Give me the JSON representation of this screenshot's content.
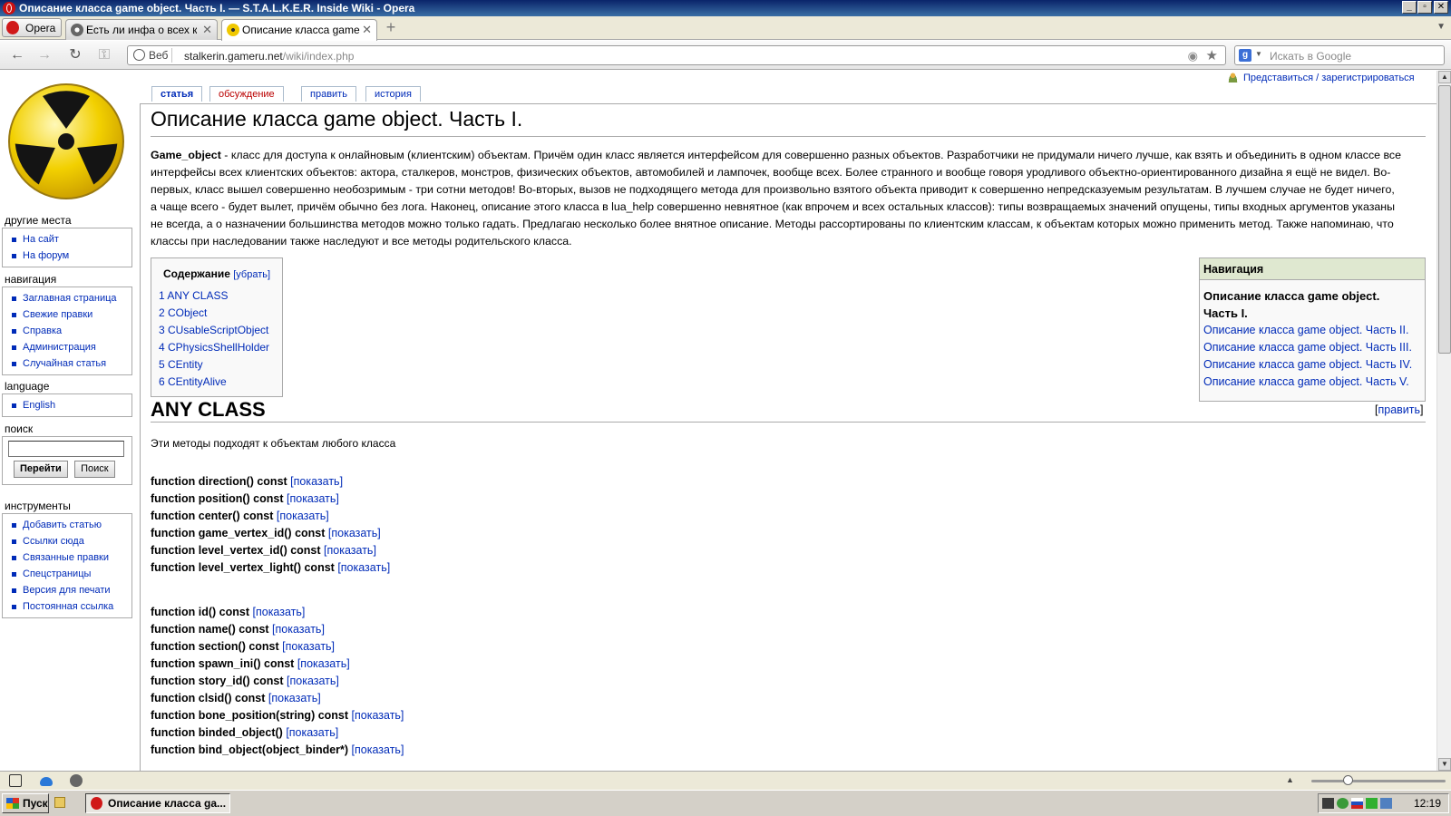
{
  "window": {
    "title": "Описание класса game object. Часть I. — S.T.A.L.K.E.R. Inside Wiki - Opera",
    "buttons": [
      "_",
      "▫",
      "✕"
    ]
  },
  "browser": {
    "menu_label": "Opera",
    "tabs": [
      {
        "label": "Есть ли инфа о всех кл...",
        "active": false
      },
      {
        "label": "Описание класса game ...",
        "active": true
      }
    ],
    "address": {
      "prefix": "Веб",
      "host": "stalkerin.gameru.net",
      "path": "/wiki/index.php"
    },
    "search_placeholder": "Искать в Google"
  },
  "wiki": {
    "user_link": "Представиться / зарегистрироваться",
    "content_tabs": {
      "article": "статья",
      "discussion": "обсуждение",
      "edit": "править",
      "history": "история"
    },
    "sidebar": {
      "other_places": {
        "title": "другие места",
        "items": [
          "На сайт",
          "На форум"
        ]
      },
      "navigation": {
        "title": "навигация",
        "items": [
          "Заглавная страница",
          "Свежие правки",
          "Справка",
          "Администрация",
          "Случайная статья"
        ]
      },
      "language": {
        "title": "language",
        "items": [
          "English"
        ]
      },
      "search": {
        "title": "поиск",
        "go_label": "Перейти",
        "search_label": "Поиск"
      },
      "tools": {
        "title": "инструменты",
        "items": [
          "Добавить статью",
          "Ссылки сюда",
          "Связанные правки",
          "Спецстраницы",
          "Версия для печати",
          "Постоянная ссылка"
        ]
      }
    },
    "page_title": "Описание класса game object. Часть I.",
    "intro": {
      "term": "Game_object",
      "text": " - класс для доступа к онлайновым (клиентским) объектам. Причём один класс является интерфейсом для совершенно разных объектов. Разработчики не придумали ничего лучше, как взять и объединить в одном классе все интерфейсы всех клиентских объектов: актора, сталкеров, монстров, физических объектов, автомобилей и лампочек, вообще всех. Более странного и вообще говоря уродливого объектно-ориентированного дизайна я ещё не видел. Во-первых, класс вышел совершенно необозримым - три сотни методов! Во-вторых, вызов не подходящего метода для произвольно взятого объекта приводит к совершенно непредсказуемым результатам. В лучшем случае не будет ничего, а чаще всего - будет вылет, причём обычно без лога. Наконец, описание этого класса в lua_help совершенно невнятное (как впрочем и всех остальных классов): типы возвращаемых значений опущены, типы входных аргументов указаны не всегда, а о назначении большинства методов можно только гадать. Предлагаю несколько более внятное описание. Методы рассортированы по клиентским классам, к объектам которых можно применить метод. Также напоминаю, что классы при наследовании также наследуют и все методы родительского класса."
    },
    "toc": {
      "title": "Содержание",
      "toggle": "[убрать]",
      "items": [
        "1 ANY CLASS",
        "2 CObject",
        "3 CUsableScriptObject",
        "4 CPhysicsShellHolder",
        "5 CEntity",
        "6 CEntityAlive"
      ]
    },
    "navbox": {
      "title": "Навигация",
      "current_line1": "Описание класса game object.",
      "current_line2": "Часть I.",
      "links": [
        "Описание класса game object. Часть II.",
        "Описание класса game object. Часть III.",
        "Описание класса game object. Часть IV.",
        "Описание класса game object. Часть V."
      ]
    },
    "section": {
      "heading": "ANY CLASS",
      "edit_link": "править",
      "description": "Эти методы подходят к объектам любого класса",
      "show_label": "[показать]",
      "functions_group1": [
        "function direction() const",
        "function position() const",
        "function center() const",
        "function game_vertex_id() const",
        "function level_vertex_id() const",
        "function level_vertex_light() const"
      ],
      "functions_group2": [
        "function id() const",
        "function name() const",
        "function section() const",
        "function spawn_ini() const",
        "function story_id() const",
        "function clsid() const",
        "function bone_position(string) const",
        "function binded_object()",
        "function bind_object(object_binder*)"
      ]
    }
  },
  "taskbar": {
    "start_label": "Пуск",
    "task_label": "Описание класса ga...",
    "clock": "12:19"
  }
}
